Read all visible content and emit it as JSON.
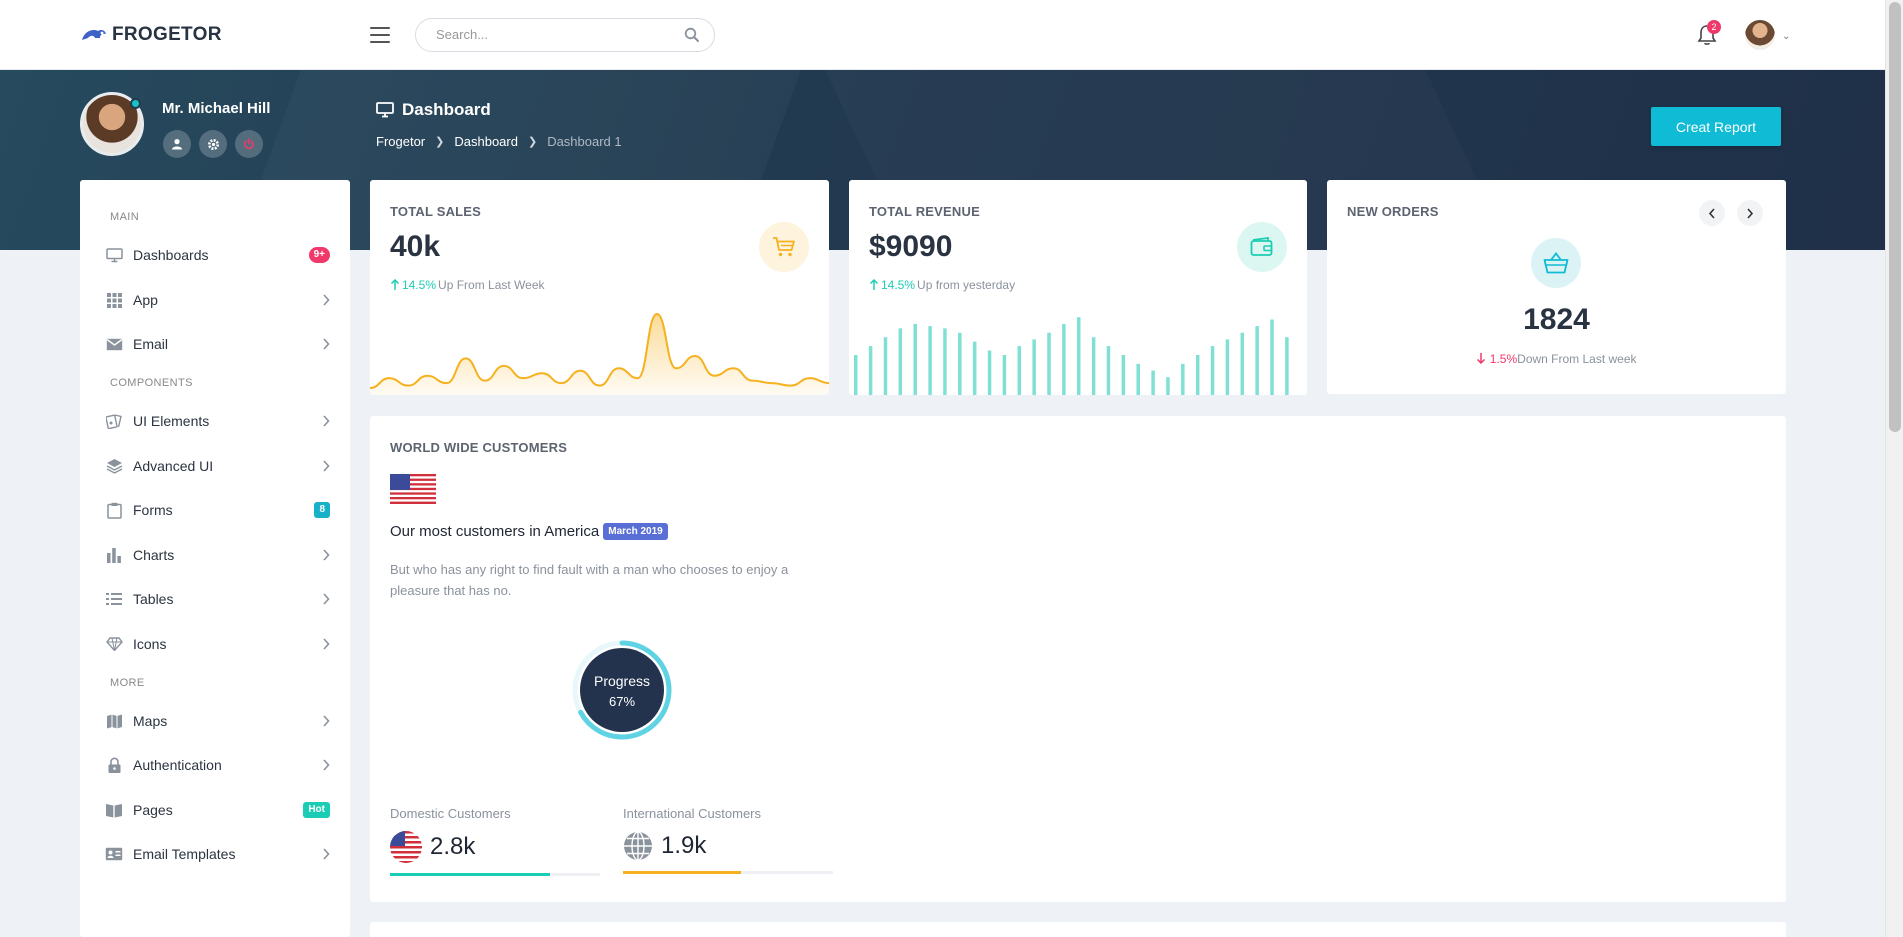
{
  "brand": {
    "name": "FROGETOR"
  },
  "topbar": {
    "search_placeholder": "Search...",
    "notification_count": "2"
  },
  "profile": {
    "name": "Mr. Michael Hill"
  },
  "header": {
    "title": "Dashboard",
    "breadcrumb": [
      "Frogetor",
      "Dashboard",
      "Dashboard 1"
    ],
    "report_button": "Creat Report"
  },
  "sidebar": {
    "sections": {
      "main": "MAIN",
      "components": "COMPONENTS",
      "more": "MORE"
    },
    "items": [
      {
        "label": "Dashboards",
        "icon": "monitor-icon",
        "badge": "9+"
      },
      {
        "label": "App",
        "icon": "grid-icon"
      },
      {
        "label": "Email",
        "icon": "mail-icon"
      },
      {
        "label": "UI Elements",
        "icon": "palette-icon"
      },
      {
        "label": "Advanced UI",
        "icon": "layers-icon"
      },
      {
        "label": "Forms",
        "icon": "clipboard-icon",
        "badge": "8"
      },
      {
        "label": "Charts",
        "icon": "bar-chart-icon"
      },
      {
        "label": "Tables",
        "icon": "list-icon"
      },
      {
        "label": "Icons",
        "icon": "diamond-icon"
      },
      {
        "label": "Maps",
        "icon": "map-icon"
      },
      {
        "label": "Authentication",
        "icon": "lock-icon"
      },
      {
        "label": "Pages",
        "icon": "book-icon",
        "badge": "Hot"
      },
      {
        "label": "Email Templates",
        "icon": "id-card-icon"
      }
    ]
  },
  "cards": {
    "total_sales": {
      "title": "TOTAL SALES",
      "value": "40k",
      "pct": "14.5%",
      "trend_text": "Up From Last Week"
    },
    "total_revenue": {
      "title": "TOTAL REVENUE",
      "value": "$9090",
      "pct": "14.5%",
      "trend_text": "Up from yesterday"
    },
    "new_orders": {
      "title": "NEW ORDERS",
      "value": "1824",
      "pct": "1.5%",
      "trend_text": "Down From Last week"
    }
  },
  "worldwide": {
    "title": "WORLD WIDE CUSTOMERS",
    "heading": "Our most customers in America",
    "badge": "March 2019",
    "text": "But who has any right to find fault with a man who chooses to enjoy a pleasure that has no.",
    "progress_label": "Progress",
    "progress_value": "67%",
    "progress_fraction": 0.67,
    "domestic": {
      "label": "Domestic Customers",
      "value": "2.8k",
      "bar_fraction": 0.76
    },
    "international": {
      "label": "International Customers",
      "value": "1.9k",
      "bar_fraction": 0.56
    }
  },
  "chart_data": [
    {
      "type": "area",
      "title": "",
      "series": [
        {
          "values": [
            2,
            6,
            3,
            7,
            4,
            14,
            5,
            11,
            6,
            8,
            4,
            9,
            3,
            10,
            6,
            32,
            10,
            15,
            7,
            10,
            5,
            4,
            3,
            6,
            4
          ]
        }
      ],
      "color": "#f6b11e"
    },
    {
      "type": "bar",
      "title": "",
      "values": [
        18,
        22,
        26,
        30,
        32,
        31,
        30,
        28,
        24,
        20,
        18,
        22,
        25,
        28,
        32,
        35,
        26,
        22,
        18,
        14,
        11,
        8,
        14,
        18,
        22,
        25,
        28,
        31,
        34,
        26
      ],
      "color": "#7fe0d3"
    }
  ],
  "colors": {
    "accent": "#0fbbd5",
    "orange": "#f6b11e",
    "teal": "#1ccdb5",
    "pink": "#f0386b",
    "dark": "#22394f"
  }
}
